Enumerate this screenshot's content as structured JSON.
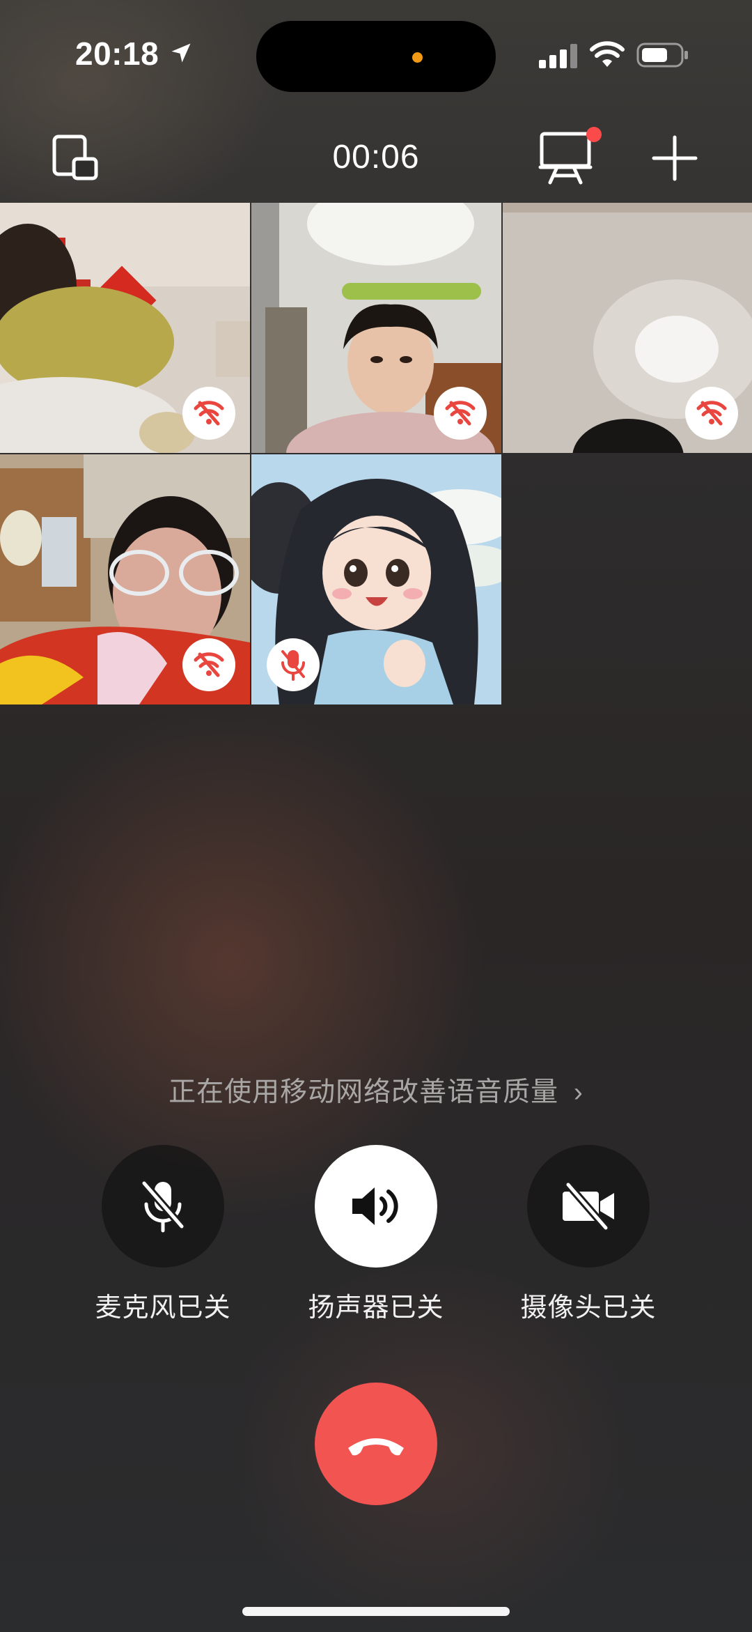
{
  "status_bar": {
    "time": "20:18",
    "icons": [
      "location-arrow-icon",
      "cellular-signal-icon",
      "wifi-icon",
      "battery-icon"
    ],
    "privacy_indicator_color": "#f29a16"
  },
  "call_header": {
    "timer": "00:06",
    "icons": [
      "float-window-icon",
      "screen-share-icon",
      "add-participant-icon"
    ],
    "notification_dot_color": "#fa4a4a"
  },
  "participants": [
    {
      "status_icon": "weak-network-icon"
    },
    {
      "status_icon": "weak-network-icon"
    },
    {
      "status_icon": "weak-network-icon"
    },
    {
      "status_icon": "weak-network-icon"
    },
    {
      "status_icon": "mic-muted-icon"
    }
  ],
  "network_hint": {
    "text": "正在使用移动网络改善语音质量",
    "chevron": "›"
  },
  "controls": {
    "microphone": {
      "label": "麦克风已关",
      "icon": "mic-off-icon"
    },
    "speaker": {
      "label": "扬声器已关",
      "icon": "speaker-icon"
    },
    "camera": {
      "label": "摄像头已关",
      "icon": "camera-off-icon"
    }
  },
  "hangup": {
    "icon": "hang-up-icon",
    "color": "#f25452"
  },
  "colors": {
    "badge_red": "#e8463f",
    "hangup_red": "#f25452"
  }
}
